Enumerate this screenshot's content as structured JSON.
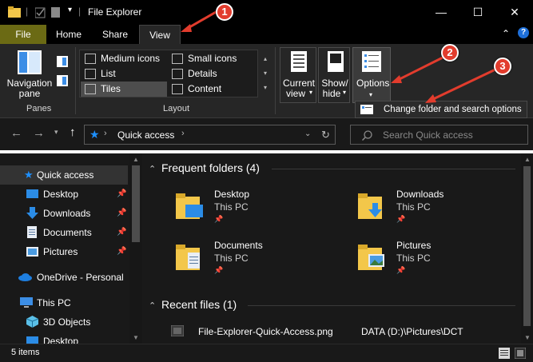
{
  "window": {
    "title": "File Explorer",
    "minimize": "—",
    "maximize": "☐",
    "close": "✕",
    "collapse_ribbon": "⌃",
    "help": "?"
  },
  "tabs": [
    {
      "label": "File"
    },
    {
      "label": "Home"
    },
    {
      "label": "Share"
    },
    {
      "label": "View"
    }
  ],
  "ribbon": {
    "panes": {
      "navigation_pane_line1": "Navigation",
      "navigation_pane_line2": "pane",
      "group_label": "Panes"
    },
    "layout": {
      "group_label": "Layout",
      "options": [
        {
          "label": "Medium icons",
          "selected": false
        },
        {
          "label": "Small icons",
          "selected": false
        },
        {
          "label": "List",
          "selected": false
        },
        {
          "label": "Details",
          "selected": false
        },
        {
          "label": "Tiles",
          "selected": true
        },
        {
          "label": "Content",
          "selected": false
        }
      ]
    },
    "current_view": {
      "line1": "Current",
      "line2": "view"
    },
    "show_hide": {
      "line1": "Show/",
      "line2": "hide"
    },
    "options": {
      "label": "Options"
    },
    "options_menu_item": "Change folder and search options"
  },
  "address": {
    "location": "Quick access",
    "search_placeholder": "Search Quick access"
  },
  "nav_pane": {
    "items": [
      {
        "label": "Quick access",
        "pinned": false
      },
      {
        "label": "Desktop",
        "pinned": true
      },
      {
        "label": "Downloads",
        "pinned": true
      },
      {
        "label": "Documents",
        "pinned": true
      },
      {
        "label": "Pictures",
        "pinned": true
      },
      {
        "label": "OneDrive - Personal",
        "pinned": false
      },
      {
        "label": "This PC",
        "pinned": false
      },
      {
        "label": "3D Objects",
        "pinned": false
      },
      {
        "label": "Desktop",
        "pinned": false
      }
    ]
  },
  "content": {
    "frequent_header": "Frequent folders (4)",
    "folders": [
      {
        "name": "Desktop",
        "location": "This PC"
      },
      {
        "name": "Downloads",
        "location": "This PC"
      },
      {
        "name": "Documents",
        "location": "This PC"
      },
      {
        "name": "Pictures",
        "location": "This PC"
      }
    ],
    "recent_header": "Recent files (1)",
    "recent_files": [
      {
        "name": "File-Explorer-Quick-Access.png",
        "path": "DATA (D:)\\Pictures\\DCT"
      }
    ]
  },
  "status": {
    "item_count": "5 items"
  },
  "annotations": [
    {
      "label": "1"
    },
    {
      "label": "2"
    },
    {
      "label": "3"
    }
  ],
  "colors": {
    "accent_file_tab": "#6b6a14",
    "annotation_red": "#e23c2d",
    "quick_access_blue": "#1e90ff",
    "folder_yellow": "#f3c74a"
  }
}
